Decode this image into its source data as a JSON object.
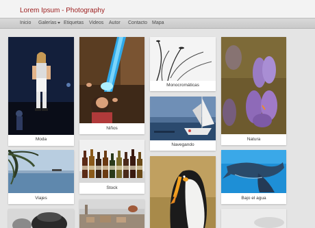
{
  "site": {
    "brand": "Lorem Ipsum - Photography"
  },
  "nav": {
    "items": [
      {
        "label": "Inicio"
      },
      {
        "label": "Galerías",
        "has_dropdown": true
      },
      {
        "label": "Etiquetas"
      },
      {
        "label": "Videos"
      },
      {
        "label": "Autor"
      },
      {
        "label": "Contacto"
      },
      {
        "label": "Mapa"
      }
    ]
  },
  "gallery": {
    "albums": [
      {
        "caption": "Moda"
      },
      {
        "caption": "Niños"
      },
      {
        "caption": "Monocromáticas"
      },
      {
        "caption": "Navegando"
      },
      {
        "caption": "Natura"
      },
      {
        "caption": "Viajes"
      },
      {
        "caption": "Stock"
      },
      {
        "caption": "Bajo el agua"
      },
      {
        "caption": ""
      },
      {
        "caption": ""
      },
      {
        "caption": ""
      },
      {
        "caption": ""
      }
    ]
  },
  "colors": {
    "brand": "#9b1b1b",
    "page_bg": "#e4e4e4",
    "navbar": "#d0d0d0"
  }
}
